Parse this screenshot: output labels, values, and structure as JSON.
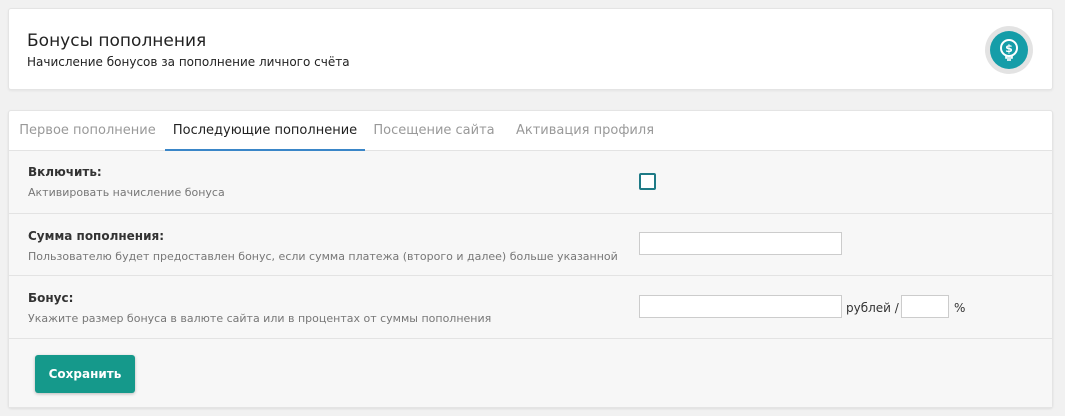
{
  "header": {
    "title": "Бонусы пополнения",
    "subtitle": "Начисление бонусов за пополнение личного счёта",
    "icon": "dollar-bulb-icon"
  },
  "tabs": [
    {
      "label": "Первое пополнение",
      "active": false
    },
    {
      "label": "Последующие пополнение",
      "active": true
    },
    {
      "label": "Посещение сайта",
      "active": false
    },
    {
      "label": "Активация профиля",
      "active": false
    }
  ],
  "rows": {
    "enable": {
      "label": "Включить:",
      "description": "Активировать начисление бонуса",
      "checked": false
    },
    "amount": {
      "label": "Сумма пополнения:",
      "description": "Пользователю будет предоставлен бонус, если сумма платежа (второго и далее) больше указанной",
      "value": ""
    },
    "bonus": {
      "label": "Бонус:",
      "description": "Укажите размер бонуса в валюте сайта или в процентах от суммы пополнения",
      "rub_value": "",
      "rub_unit": "рублей /",
      "percent_value": "",
      "percent_unit": "%"
    }
  },
  "actions": {
    "save_label": "Сохранить"
  },
  "colors": {
    "accent": "#15998b",
    "tab_underline": "#3a86c8",
    "icon_bg": "#159da8"
  }
}
